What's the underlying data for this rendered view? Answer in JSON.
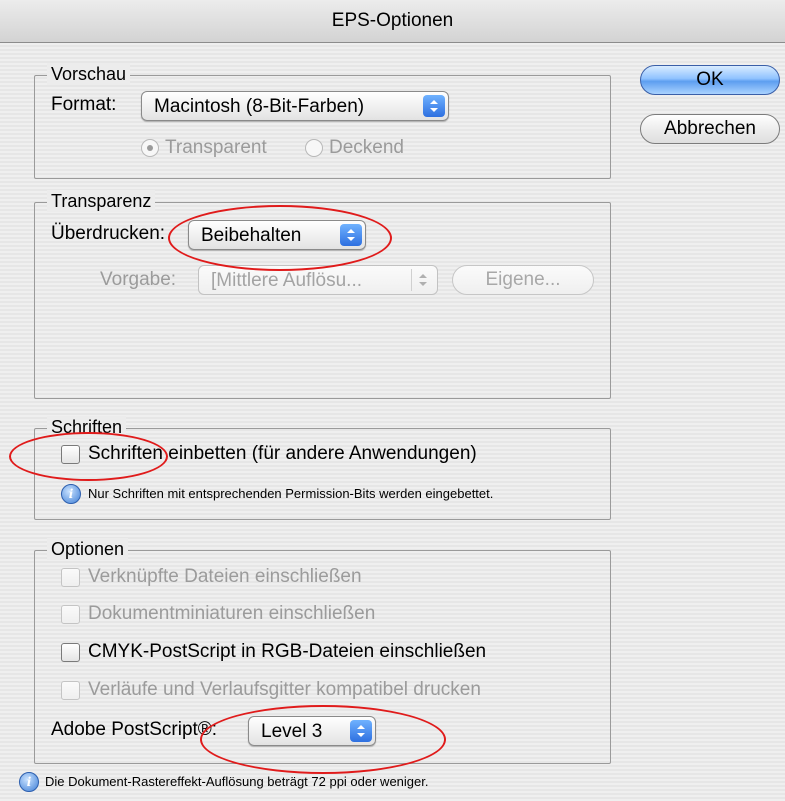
{
  "window": {
    "title": "EPS-Optionen"
  },
  "buttons": {
    "ok": "OK",
    "cancel": "Abbrechen"
  },
  "preview": {
    "legend": "Vorschau",
    "format_label": "Format:",
    "format_value": "Macintosh (8-Bit-Farben)",
    "radio_transparent": "Transparent",
    "radio_opaque": "Deckend"
  },
  "transparency": {
    "legend": "Transparenz",
    "overprint_label": "Überdrucken:",
    "overprint_value": "Beibehalten",
    "preset_label": "Vorgabe:",
    "preset_value": "[Mittlere Auflösu...",
    "custom_button": "Eigene..."
  },
  "fonts": {
    "legend": "Schriften",
    "embed_label": "Schriften einbetten (für andere Anwendungen)",
    "info_text": "Nur Schriften mit entsprechenden Permission-Bits werden eingebettet."
  },
  "options": {
    "legend": "Optionen",
    "include_linked": "Verknüpfte Dateien einschließen",
    "include_thumbnails": "Dokumentminiaturen einschließen",
    "include_cmyk": "CMYK-PostScript in RGB-Dateien einschließen",
    "compatible_gradients": "Verläufe und Verlaufsgitter kompatibel drucken",
    "postscript_label": "Adobe PostScript®:",
    "postscript_value": "Level 3"
  },
  "footer": {
    "info_text": "Die Dokument-Rastereffekt-Auflösung beträgt 72 ppi oder weniger."
  },
  "colors": {
    "highlight_ellipse": "#e01b1b",
    "default_button": "#5d9ef0"
  }
}
